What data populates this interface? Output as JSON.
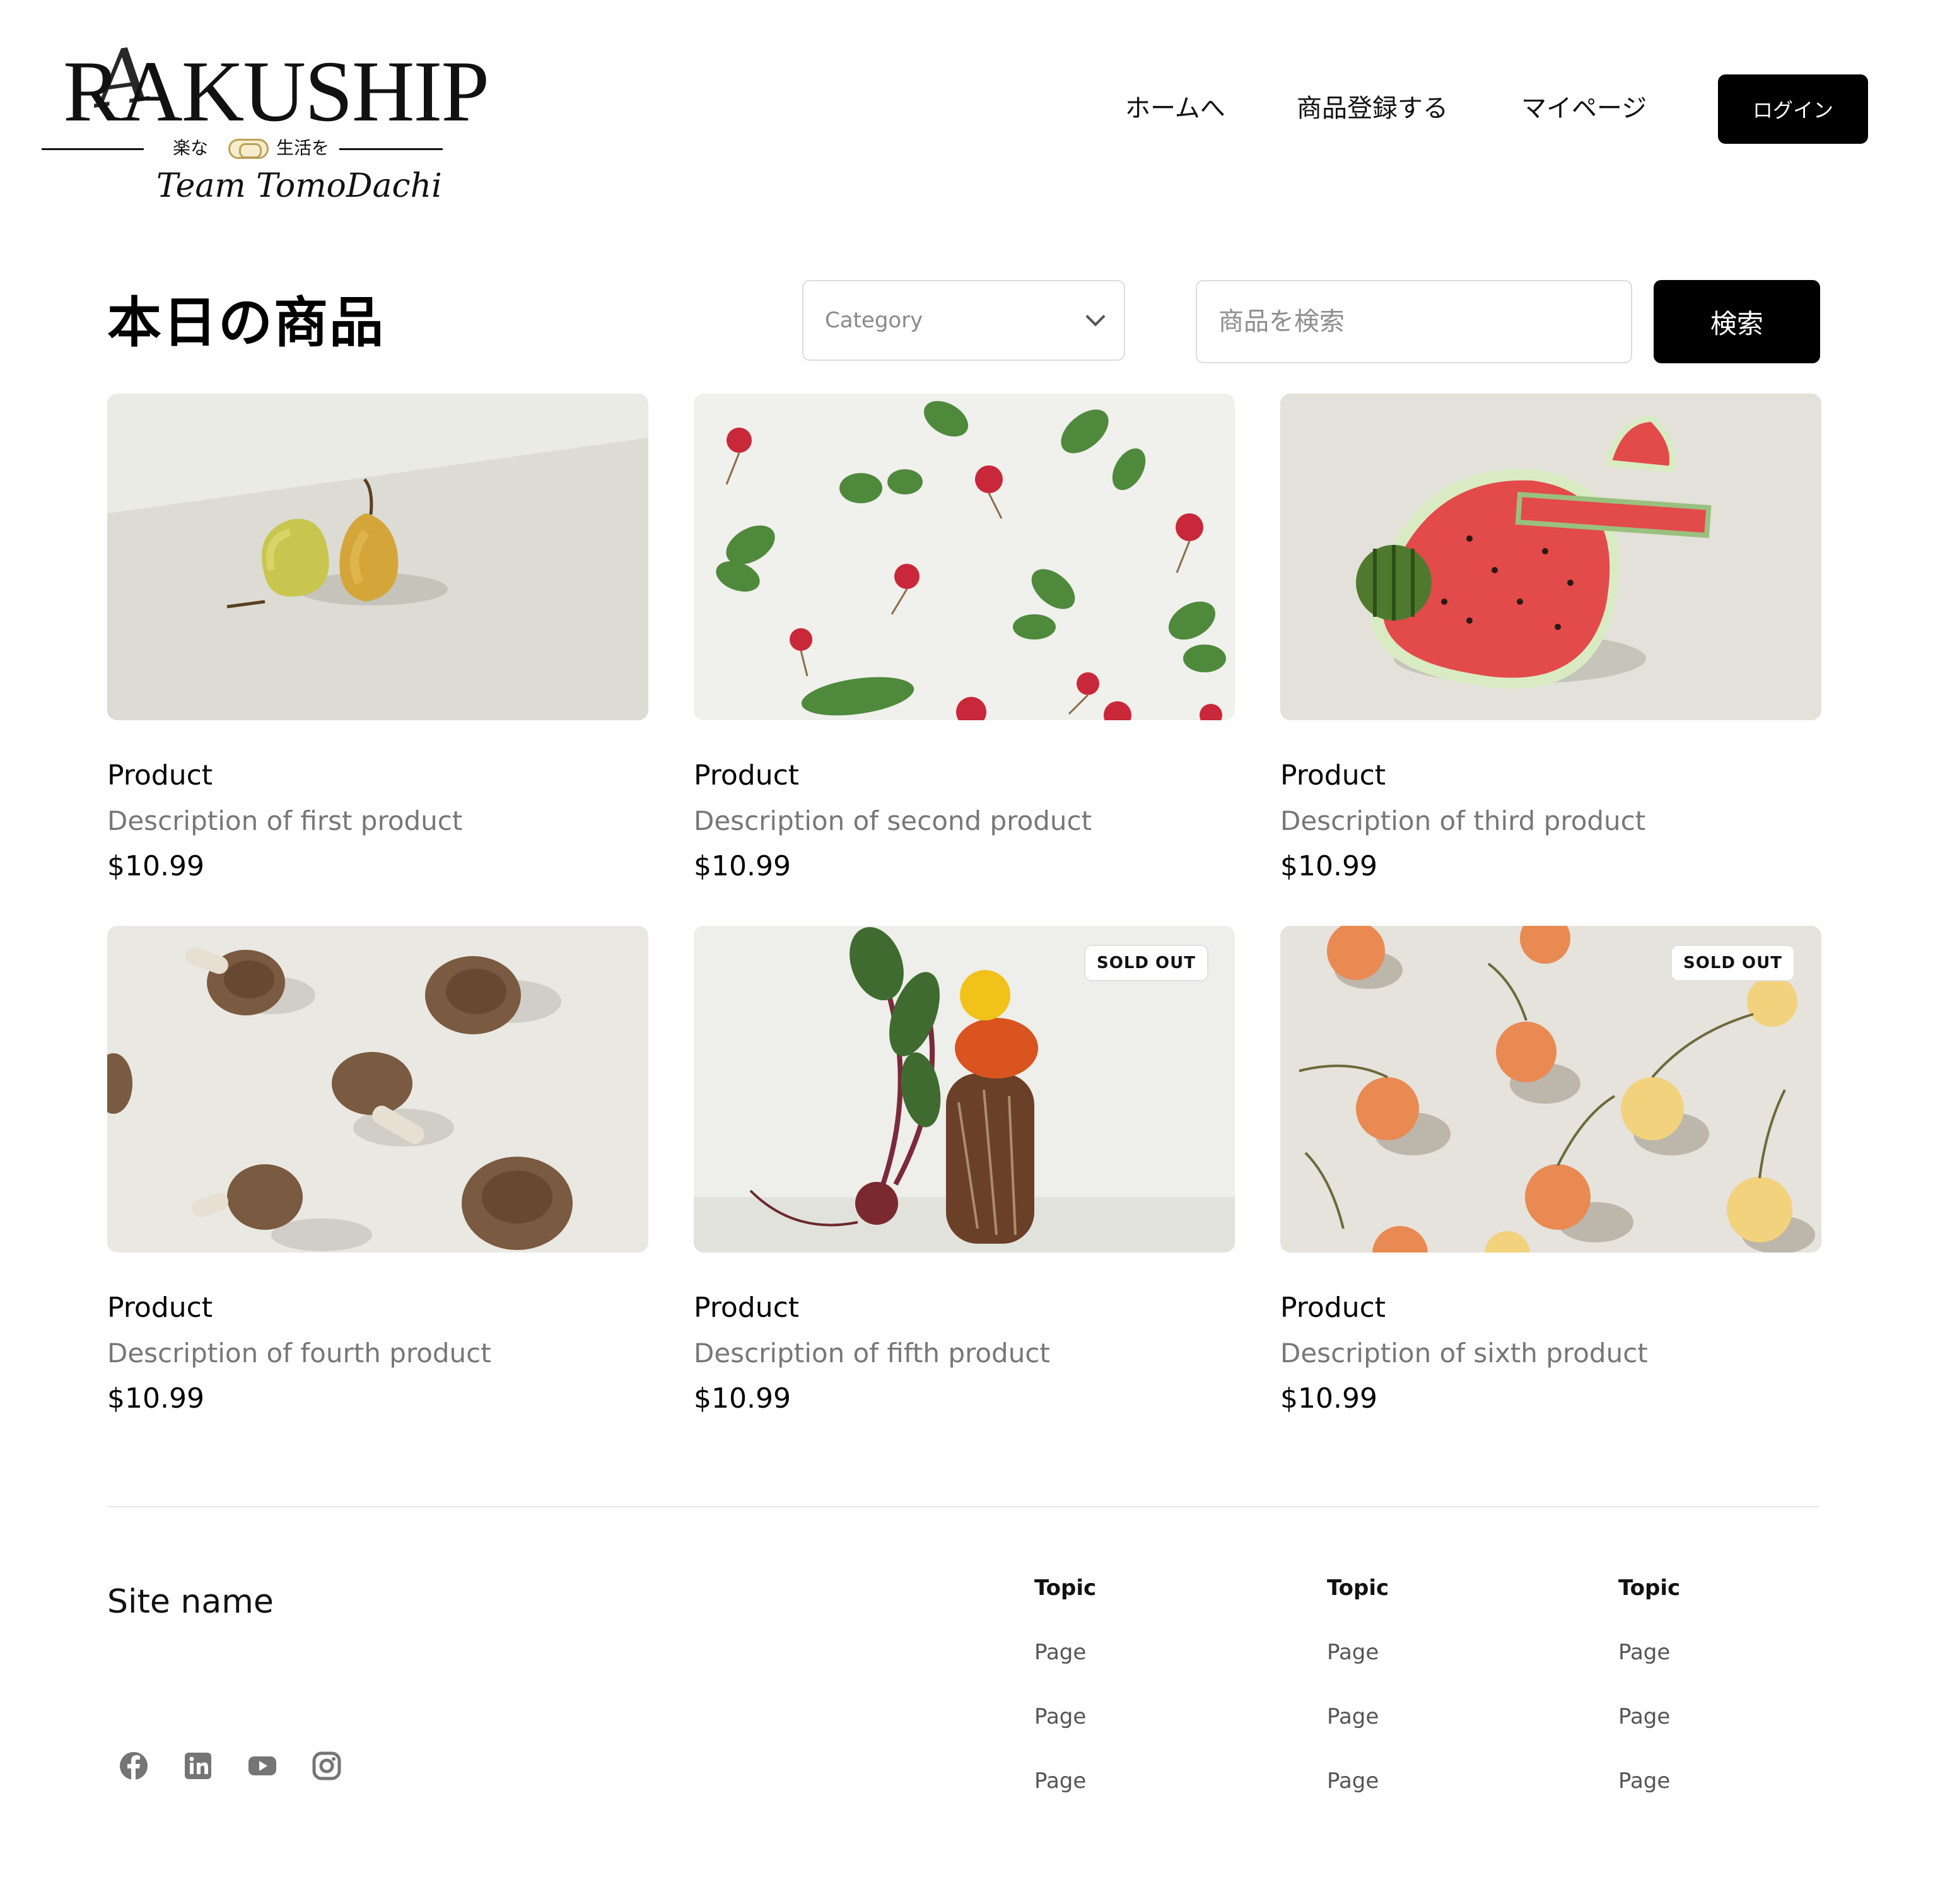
{
  "header": {
    "logo_word": "RAKUSHIP",
    "logo_script": "A",
    "logo_tag_left": "楽な",
    "logo_tag_right": "生活を",
    "logo_team": "Team TomoDachi",
    "nav": [
      "ホームへ",
      "商品登録する",
      "マイページ"
    ],
    "login_label": "ログイン"
  },
  "toolbar": {
    "title": "本日の商品",
    "category_placeholder": "Category",
    "search_placeholder": "商品を検索",
    "search_label": "検索"
  },
  "products": [
    {
      "name": "Product",
      "description": "Description of first product",
      "price": "$10.99",
      "image": "pears",
      "sold_out": false
    },
    {
      "name": "Product",
      "description": "Description of second product",
      "price": "$10.99",
      "image": "radishes",
      "sold_out": false
    },
    {
      "name": "Product",
      "description": "Description of third product",
      "price": "$10.99",
      "image": "watermelon",
      "sold_out": false
    },
    {
      "name": "Product",
      "description": "Description of fourth product",
      "price": "$10.99",
      "image": "mushrooms",
      "sold_out": false
    },
    {
      "name": "Product",
      "description": "Description of fifth product",
      "price": "$10.99",
      "image": "beet-bread-tomato",
      "sold_out": true
    },
    {
      "name": "Product",
      "description": "Description of sixth product",
      "price": "$10.99",
      "image": "cherries",
      "sold_out": true
    }
  ],
  "sold_out_label": "SOLD OUT",
  "footer": {
    "site_name": "Site name",
    "social_icons": [
      "facebook-icon",
      "linkedin-icon",
      "youtube-icon",
      "instagram-icon"
    ],
    "columns": [
      {
        "topic": "Topic",
        "pages": [
          "Page",
          "Page",
          "Page"
        ]
      },
      {
        "topic": "Topic",
        "pages": [
          "Page",
          "Page",
          "Page"
        ]
      },
      {
        "topic": "Topic",
        "pages": [
          "Page",
          "Page",
          "Page"
        ]
      }
    ]
  },
  "colors": {
    "accent": "#000000",
    "muted_text": "#777777",
    "border": "#dcdcdc",
    "logo_gold": "#b9a25a"
  }
}
